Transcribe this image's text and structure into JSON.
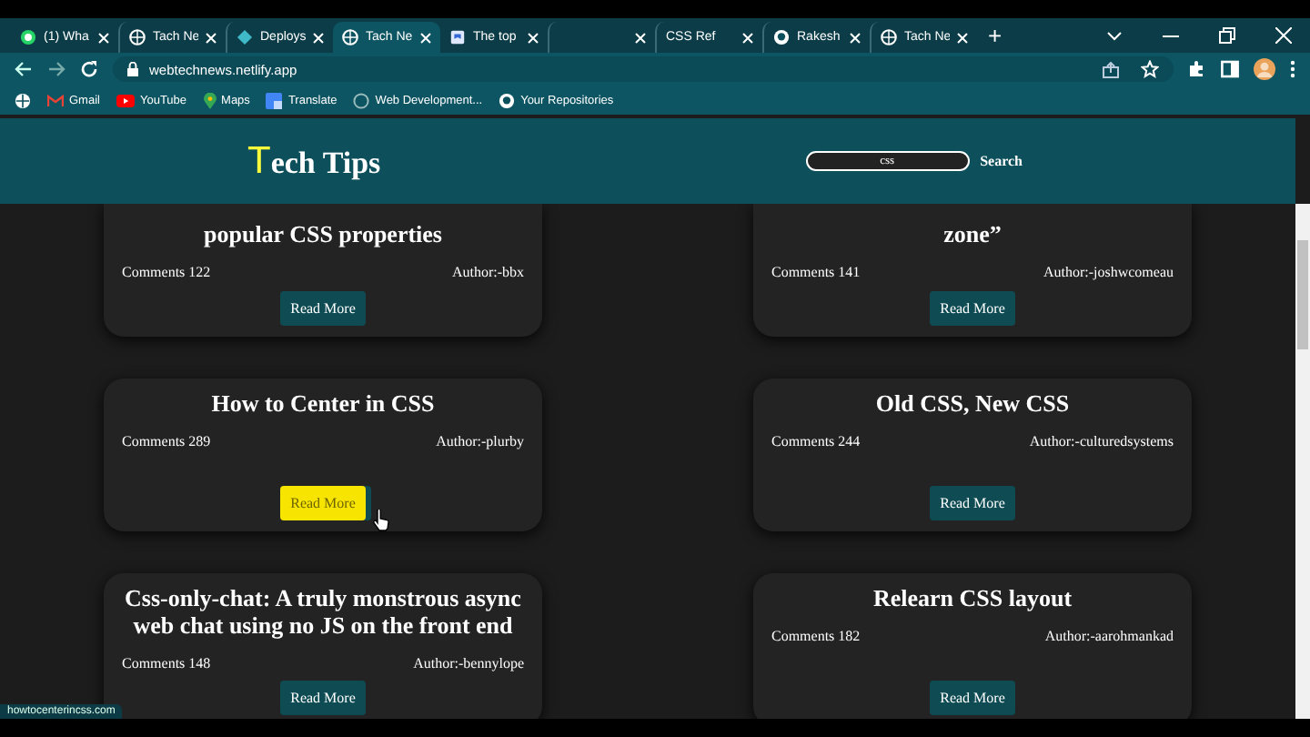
{
  "browser": {
    "tabs": [
      {
        "title": "(1) Wha",
        "selected": false
      },
      {
        "title": "Tach Ne",
        "selected": false
      },
      {
        "title": "Deploys",
        "selected": false
      },
      {
        "title": "Tach Ne",
        "selected": true
      },
      {
        "title": "The top",
        "selected": false
      },
      {
        "selected": false
      },
      {
        "title": "CSS Ref",
        "selected": false
      },
      {
        "title": "Rakesh",
        "selected": false
      },
      {
        "title": "Tach Ne",
        "selected": false
      }
    ],
    "new_tab": "+",
    "url": "webtechnews.netlify.app",
    "bookmarks": [
      "Gmail",
      "YouTube",
      "Maps",
      "Translate",
      "Web Development...",
      "Your Repositories"
    ],
    "status_url": "howtocenterincss.com"
  },
  "header": {
    "logo_initial": "T",
    "logo_rest": "ech Tips",
    "search": {
      "value": "css"
    },
    "search_button": "Search"
  },
  "cards": [
    {
      "title": "popular CSS properties",
      "cut": true,
      "comments": "Comments 122",
      "author": "Author:-bbx",
      "button": "Read More",
      "hovered": false
    },
    {
      "title": "zone”",
      "cut": true,
      "comments": "Comments 141",
      "author": "Author:-joshwcomeau",
      "button": "Read More",
      "hovered": false
    },
    {
      "title": "How to Center in CSS",
      "cut": false,
      "comments": "Comments 289",
      "author": "Author:-plurby",
      "button": "Read More",
      "hovered": true
    },
    {
      "title": "Old CSS, New CSS",
      "cut": false,
      "comments": "Comments 244",
      "author": "Author:-culturedsystems",
      "button": "Read More",
      "hovered": false
    },
    {
      "title": "Css-only-chat: A truly monstrous async web chat using no JS on the front end",
      "cut": false,
      "comments": "Comments 148",
      "author": "Author:-bennylope",
      "button": "Read More",
      "hovered": false
    },
    {
      "title": "Relearn CSS layout",
      "cut": false,
      "comments": "Comments 182",
      "author": "Author:-aarohmankad",
      "button": "Read More",
      "hovered": false
    }
  ]
}
